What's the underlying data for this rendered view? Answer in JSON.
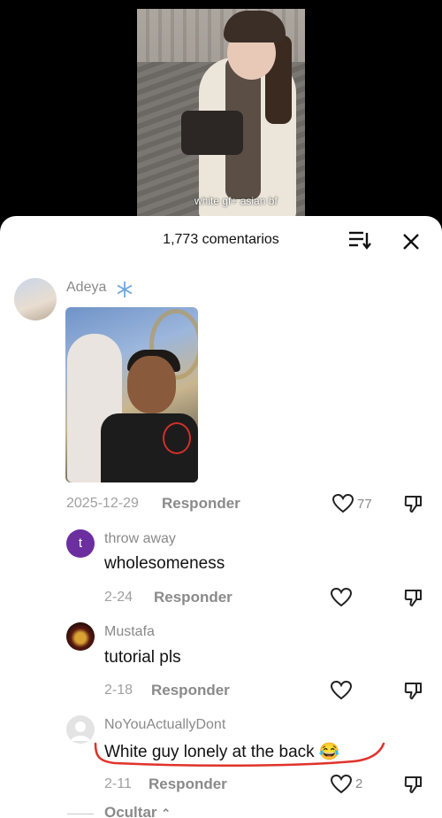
{
  "video": {
    "caption": "white gf+ asian bf"
  },
  "header": {
    "count_label": "1,773 comentarios"
  },
  "comments": [
    {
      "author": "Adeya",
      "author_badge": "snowflake-icon",
      "date": "2025-12-29",
      "reply_label": "Responder",
      "likes": "77",
      "has_photo": true
    },
    {
      "author": "throw away",
      "avatar_letter": "t",
      "text": "wholesomeness",
      "date": "2-24",
      "reply_label": "Responder"
    },
    {
      "author": "Mustafa",
      "text": "tutorial pls",
      "date": "2-18",
      "reply_label": "Responder"
    },
    {
      "author": "NoYouActuallyDont",
      "text": "White guy lonely at the back 😂",
      "date": "2-11",
      "reply_label": "Responder",
      "likes": "2"
    }
  ],
  "hide_label": "Ocultar",
  "colors": {
    "avatar_t": "#6b2fa0",
    "underline": "#e0322b"
  }
}
